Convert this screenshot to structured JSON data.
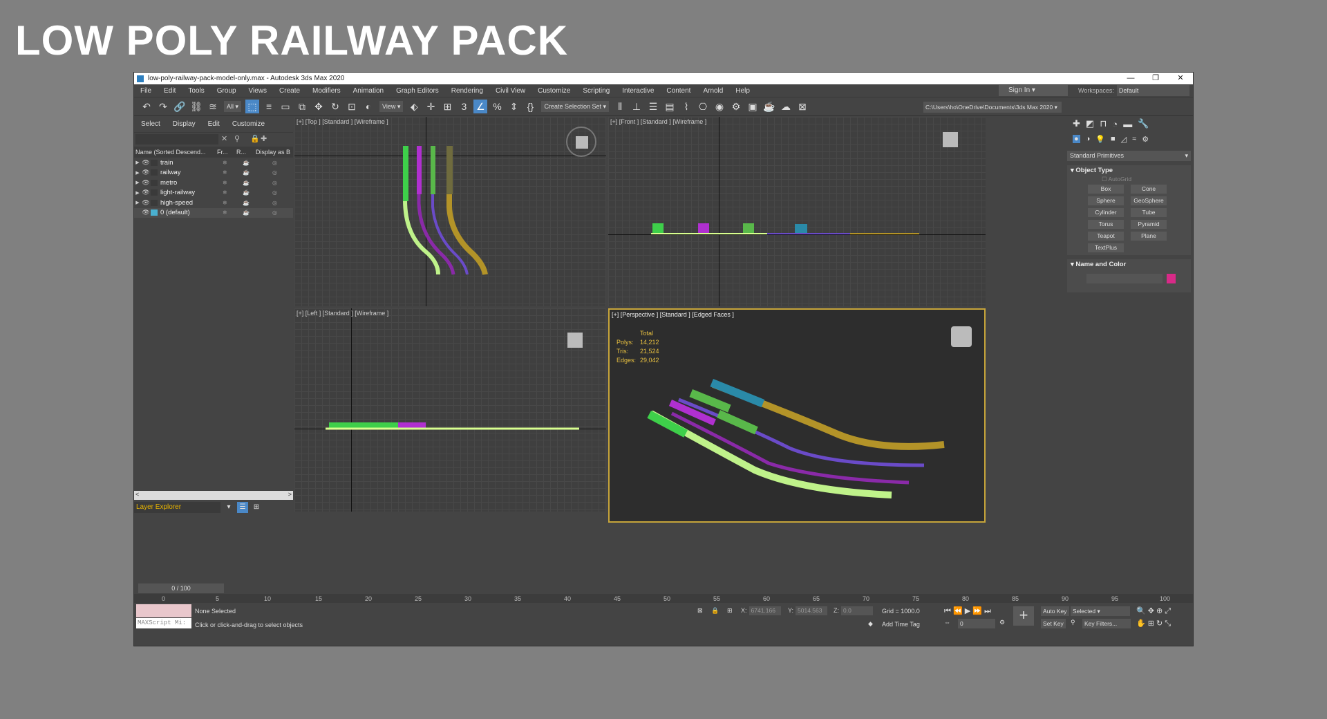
{
  "banner": "LOW POLY RAILWAY PACK",
  "window": {
    "title": "low-poly-railway-pack-model-only.max - Autodesk 3ds Max 2020"
  },
  "menu": [
    "File",
    "Edit",
    "Tools",
    "Group",
    "Views",
    "Create",
    "Modifiers",
    "Animation",
    "Graph Editors",
    "Rendering",
    "Civil View",
    "Customize",
    "Scripting",
    "Interactive",
    "Content",
    "Arnold",
    "Help"
  ],
  "signin": "Sign In",
  "workspaces": {
    "label": "Workspaces:",
    "value": "Default"
  },
  "toolbar": {
    "filter": "All",
    "view": "View",
    "selection_set": "Create Selection Set",
    "path": "C:\\Users\\ho\\OneDrive\\Documents\\3ds Max 2020"
  },
  "explorer": {
    "tabs": [
      "Select",
      "Display",
      "Edit",
      "Customize"
    ],
    "headers": [
      "Name (Sorted Descend...",
      "Fr...",
      "R...",
      "Display as B"
    ],
    "layers": [
      {
        "name": "train",
        "color": "#3a3a3a"
      },
      {
        "name": "railway",
        "color": "#3a3a3a"
      },
      {
        "name": "metro",
        "color": "#3a3a3a"
      },
      {
        "name": "light-railway",
        "color": "#3a3a3a"
      },
      {
        "name": "high-speed",
        "color": "#3a3a3a"
      },
      {
        "name": "0 (default)",
        "color": "#3a3a3a"
      }
    ],
    "footer_label": "Layer Explorer",
    "frame": "0 / 100"
  },
  "viewports": {
    "top": "[+] [Top ] [Standard ] [Wireframe ]",
    "front": "[+] [Front ] [Standard ] [Wireframe ]",
    "left": "[+] [Left ] [Standard ] [Wireframe ]",
    "persp": "[+] [Perspective ] [Standard ] [Edged Faces ]"
  },
  "stats": {
    "total": "Total",
    "polys_label": "Polys:",
    "polys": "14,212",
    "tris_label": "Tris:",
    "tris": "21,524",
    "edges_label": "Edges:",
    "edges": "29,042"
  },
  "command": {
    "dropdown": "Standard Primitives",
    "object_type": "Object Type",
    "autogrid": "AutoGrid",
    "buttons": [
      "Box",
      "Cone",
      "Sphere",
      "GeoSphere",
      "Cylinder",
      "Tube",
      "Torus",
      "Pyramid",
      "Teapot",
      "Plane",
      "TextPlus"
    ],
    "name_color": "Name and Color",
    "color": "#d82a88"
  },
  "timeline": {
    "ticks": [
      "0",
      "5",
      "10",
      "15",
      "20",
      "25",
      "30",
      "35",
      "40",
      "45",
      "50",
      "55",
      "60",
      "65",
      "70",
      "75",
      "80",
      "85",
      "90",
      "95",
      "100"
    ]
  },
  "status": {
    "maxscript": "MAXScript Mi:",
    "selected": "None Selected",
    "hint": "Click or click-and-drag to select objects",
    "x_label": "X:",
    "x": "6741.166",
    "y_label": "Y:",
    "y": "5014.563",
    "z_label": "Z:",
    "z": "0.0",
    "grid": "Grid = 1000.0",
    "add_tag": "Add Time Tag",
    "frame_val": "0",
    "autokey": "Auto Key",
    "setkey": "Set Key",
    "selected_dd": "Selected",
    "keyfilters": "Key Filters..."
  }
}
